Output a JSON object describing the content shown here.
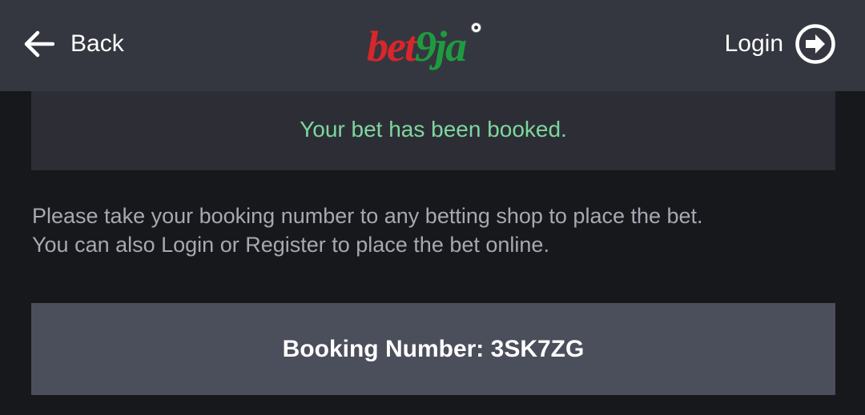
{
  "header": {
    "back_label": "Back",
    "logo": {
      "part1": "bet",
      "part2": "9ja"
    },
    "login_label": "Login"
  },
  "banner": {
    "message": "Your bet has been booked."
  },
  "info": {
    "line1": "Please take your booking number to any betting shop to place the bet.",
    "line2": "You can also Login or Register to place the bet online."
  },
  "booking": {
    "text": "Booking Number: 3SK7ZG"
  },
  "colors": {
    "header_bg": "#353740",
    "page_bg": "#17181c",
    "success_green": "#7ed69f",
    "logo_red": "#d8262a",
    "logo_green": "#1f9b3f",
    "booking_bg": "#4b4e5b"
  },
  "icons": {
    "back": "arrow-left-icon",
    "login": "circle-arrow-right-icon"
  }
}
